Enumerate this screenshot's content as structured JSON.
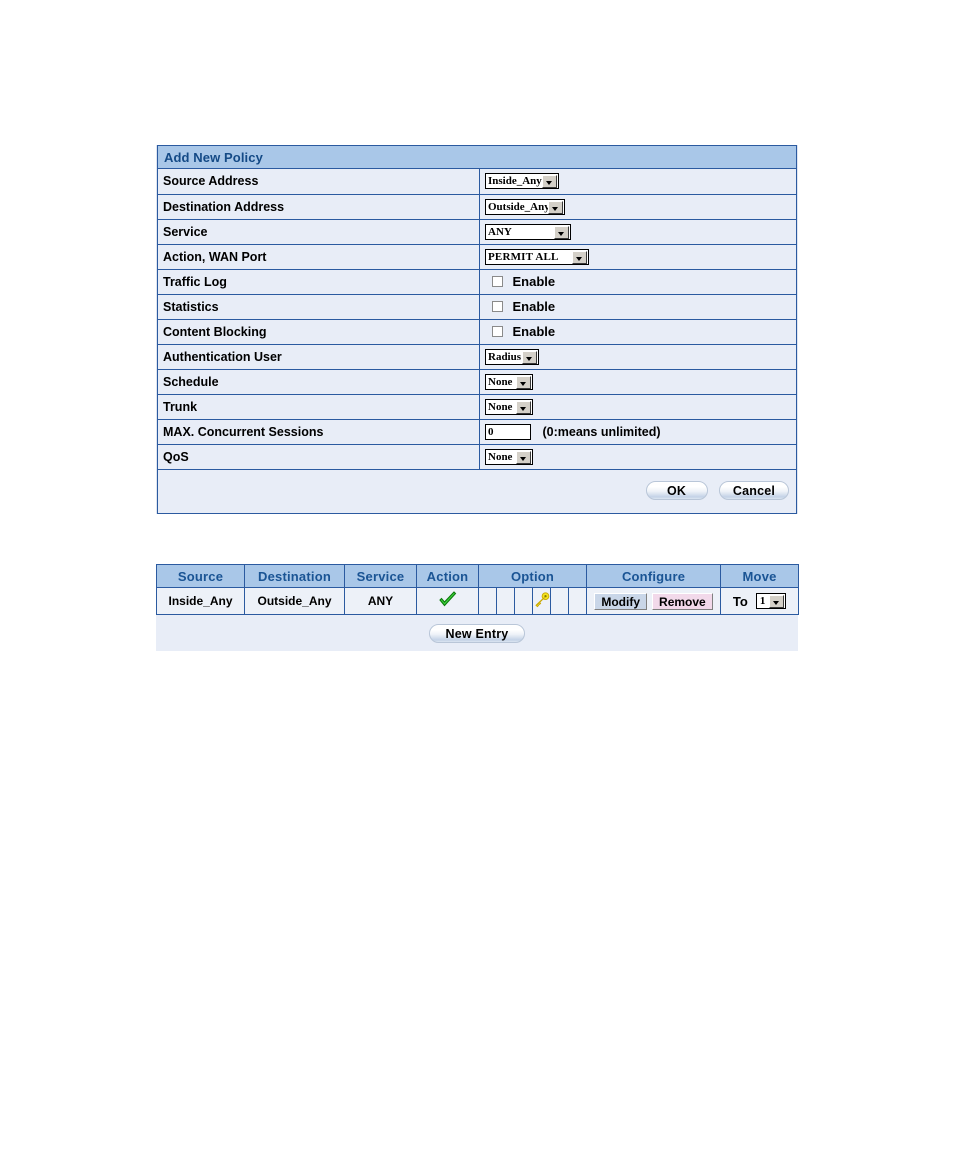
{
  "policy_form": {
    "title": "Add New Policy",
    "rows": [
      {
        "label": "Source Address",
        "control": "select",
        "value": "Inside_Any"
      },
      {
        "label": "Destination Address",
        "control": "select",
        "value": "Outside_Any"
      },
      {
        "label": "Service",
        "control": "select",
        "value": "ANY"
      },
      {
        "label": "Action, WAN Port",
        "control": "select",
        "value": "PERMIT ALL"
      },
      {
        "label": "Traffic Log",
        "control": "checkbox",
        "value": "Enable",
        "checked": false
      },
      {
        "label": "Statistics",
        "control": "checkbox",
        "value": "Enable",
        "checked": false
      },
      {
        "label": "Content Blocking",
        "control": "checkbox",
        "value": "Enable",
        "checked": false
      },
      {
        "label": "Authentication User",
        "control": "select",
        "value": "Radius"
      },
      {
        "label": "Schedule",
        "control": "select",
        "value": "None"
      },
      {
        "label": "Trunk",
        "control": "select",
        "value": "None"
      },
      {
        "label": "MAX. Concurrent Sessions",
        "control": "text",
        "value": "0",
        "hint": "(0:means unlimited)"
      },
      {
        "label": "QoS",
        "control": "select",
        "value": "None"
      }
    ],
    "buttons": {
      "ok": "OK",
      "cancel": "Cancel"
    }
  },
  "policy_list": {
    "headers": {
      "source": "Source",
      "destination": "Destination",
      "service": "Service",
      "action": "Action",
      "option": "Option",
      "configure": "Configure",
      "move": "Move"
    },
    "rows": [
      {
        "source": "Inside_Any",
        "destination": "Outside_Any",
        "service": "ANY",
        "action_icon": "green-check-icon",
        "option_icons": [
          "",
          "",
          "",
          "key-icon",
          "",
          ""
        ],
        "modify_label": "Modify",
        "remove_label": "Remove",
        "move_prefix": "To",
        "move_value": "1"
      }
    ],
    "footer": {
      "new_entry": "New Entry"
    }
  },
  "colors": {
    "panel_bg": "#e8edf7",
    "header_bg": "#a9c7e8",
    "border": "#2b5aa0",
    "header_text": "#144a86",
    "check_green": "#2fb42f",
    "key_yellow": "#f2e00a",
    "remove_pink": "#f2d9ea",
    "modify_blue": "#c9d6e8"
  }
}
